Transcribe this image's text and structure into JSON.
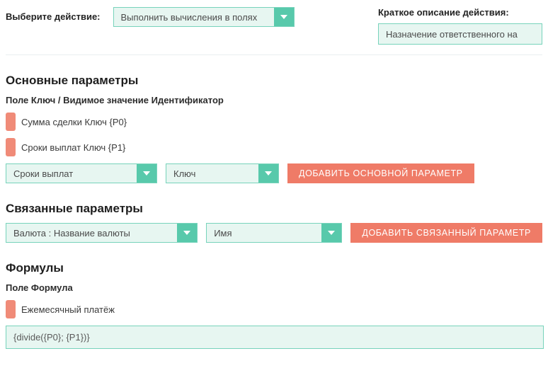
{
  "top": {
    "action_label": "Выберите действие:",
    "action_value": "Выполнить вычисления в полях",
    "desc_label": "Краткое описание действия:",
    "desc_value": "Назначение ответственного на"
  },
  "main_params": {
    "heading": "Основные параметры",
    "subhead": "Поле Ключ / Видимое значение Идентификатор",
    "items": [
      "Сумма сделки Ключ {P0}",
      "Сроки выплат Ключ {P1}"
    ],
    "field_select": "Сроки выплат",
    "key_select": "Ключ",
    "add_btn": "ДОБАВИТЬ ОСНОВНОЙ ПАРАМЕТР"
  },
  "linked_params": {
    "heading": "Связанные параметры",
    "field_select": "Валюта : Название валюты",
    "name_select": "Имя",
    "add_btn": "ДОБАВИТЬ СВЯЗАННЫЙ ПАРАМЕТР"
  },
  "formulas": {
    "heading": "Формулы",
    "subhead": "Поле Формула",
    "item": "Ежемесячный платёж",
    "expression": "{divide({P0}; {P1})}"
  }
}
